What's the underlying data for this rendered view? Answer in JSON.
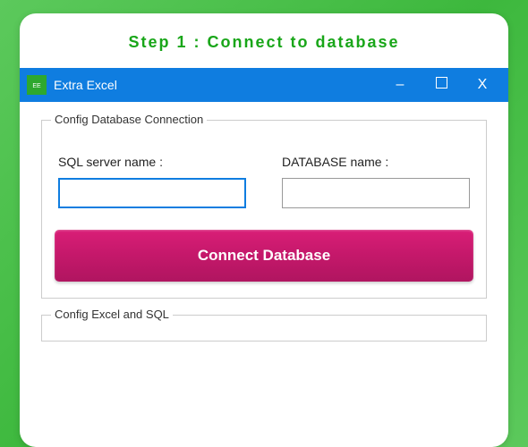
{
  "page": {
    "step_title": "Step 1 : Connect to database"
  },
  "window": {
    "app_title": "Extra Excel",
    "icon_name": "extra-excel-icon"
  },
  "groupbox1": {
    "legend": "Config Database Connection",
    "sql_server_label": "SQL server name :",
    "sql_server_value": "",
    "database_label": "DATABASE name :",
    "database_value": "",
    "connect_button_label": "Connect Database"
  },
  "groupbox2": {
    "legend": "Config Excel and SQL"
  }
}
